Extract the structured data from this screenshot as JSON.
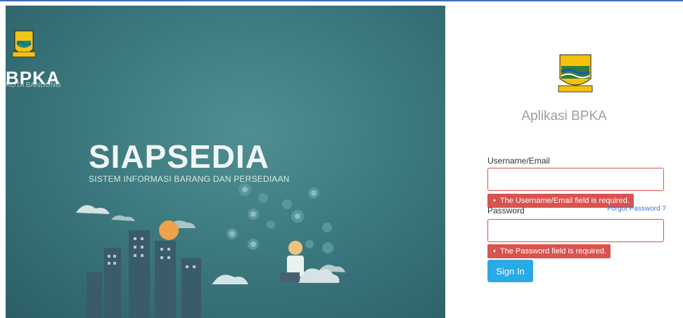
{
  "left": {
    "logo_text": "BPKA",
    "logo_sub": "KOTA BANDUNG",
    "hero_title": "SIAPSEDIA",
    "hero_subtitle": "SISTEM INFORMASI BARANG DAN PERSEDIAAN"
  },
  "right": {
    "app_title": "Aplikasi BPKA",
    "username_label": "Username/Email",
    "username_value": "",
    "username_error": "The Username/Email field is required.",
    "password_label": "Password",
    "password_value": "",
    "forgot_label": "Forgot Password ?",
    "password_error": "The Password field is required.",
    "signin_label": "Sign In"
  },
  "colors": {
    "error": "#d9534f",
    "primary": "#29a9e6",
    "link": "#3a7bd5",
    "hero_bg": "#3c7a7f"
  }
}
